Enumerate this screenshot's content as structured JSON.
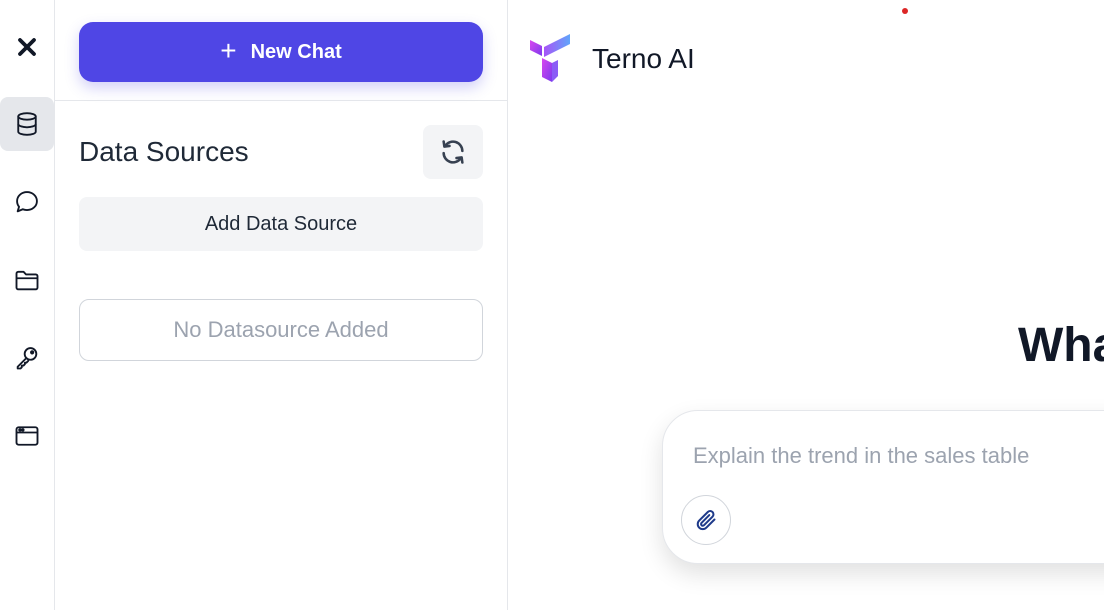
{
  "rail": {
    "items": [
      {
        "name": "close",
        "icon": "close-icon"
      },
      {
        "name": "data-sources",
        "icon": "database-icon",
        "active": true
      },
      {
        "name": "chats",
        "icon": "chat-bubble-icon"
      },
      {
        "name": "files",
        "icon": "folder-icon"
      },
      {
        "name": "keys",
        "icon": "key-icon"
      },
      {
        "name": "browser",
        "icon": "window-icon"
      }
    ]
  },
  "panel": {
    "new_chat_label": "New Chat",
    "new_chat_icon": "plus-icon",
    "title": "Data Sources",
    "refresh_icon": "refresh-icon",
    "add_label": "Add Data Source",
    "empty_text": "No Datasource Added"
  },
  "main": {
    "brand_name": "Terno AI",
    "brand_icon": "terno-logo",
    "hero_text": "Wha",
    "composer": {
      "placeholder": "Explain the trend in the sales table",
      "attach_icon": "paperclip-icon"
    }
  },
  "colors": {
    "accent": "#4f46e5",
    "border": "#e5e7eb",
    "muted_text": "#9ca3af",
    "button_bg": "#f3f4f6"
  }
}
